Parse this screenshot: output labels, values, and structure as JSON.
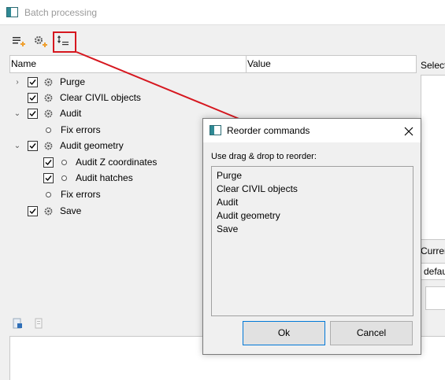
{
  "window": {
    "title": "Batch processing"
  },
  "toolbar": {
    "buttons": [
      {
        "icon": "add-command-icon"
      },
      {
        "icon": "add-settings-icon"
      },
      {
        "icon": "reorder-commands-icon"
      }
    ]
  },
  "grid": {
    "columns": [
      "Name",
      "Value"
    ],
    "rows": [
      {
        "label": "Purge",
        "expander": ">",
        "checked": true,
        "icon": "gear-icon"
      },
      {
        "label": "Clear CIVIL objects",
        "checked": true,
        "icon": "gear-icon"
      },
      {
        "label": "Audit",
        "expander": "v",
        "checked": true,
        "icon": "gear-icon"
      },
      {
        "label": "Fix errors",
        "icon": "dot-icon"
      },
      {
        "label": "Audit geometry",
        "expander": "v",
        "checked": true,
        "icon": "gear-icon"
      },
      {
        "label": "Audit Z coordinates",
        "checked": true,
        "icon": "dot-icon"
      },
      {
        "label": "Audit hatches",
        "checked": true,
        "icon": "dot-icon"
      },
      {
        "label": "Fix errors",
        "icon": "dot-icon"
      },
      {
        "label": "Save",
        "checked": true,
        "icon": "gear-icon"
      }
    ]
  },
  "right_panel": {
    "select_label": "Select",
    "current_label": "Curren",
    "default_value": "defau"
  },
  "dialog": {
    "title": "Reorder commands",
    "hint": "Use drag & drop to reorder:",
    "items": [
      "Purge",
      "Clear CIVIL objects",
      "Audit",
      "Audit geometry",
      "Save"
    ],
    "ok_label": "Ok",
    "cancel_label": "Cancel"
  },
  "colors": {
    "callout": "#d6171f",
    "accent": "#0078d7",
    "orange": "#f0a030"
  }
}
